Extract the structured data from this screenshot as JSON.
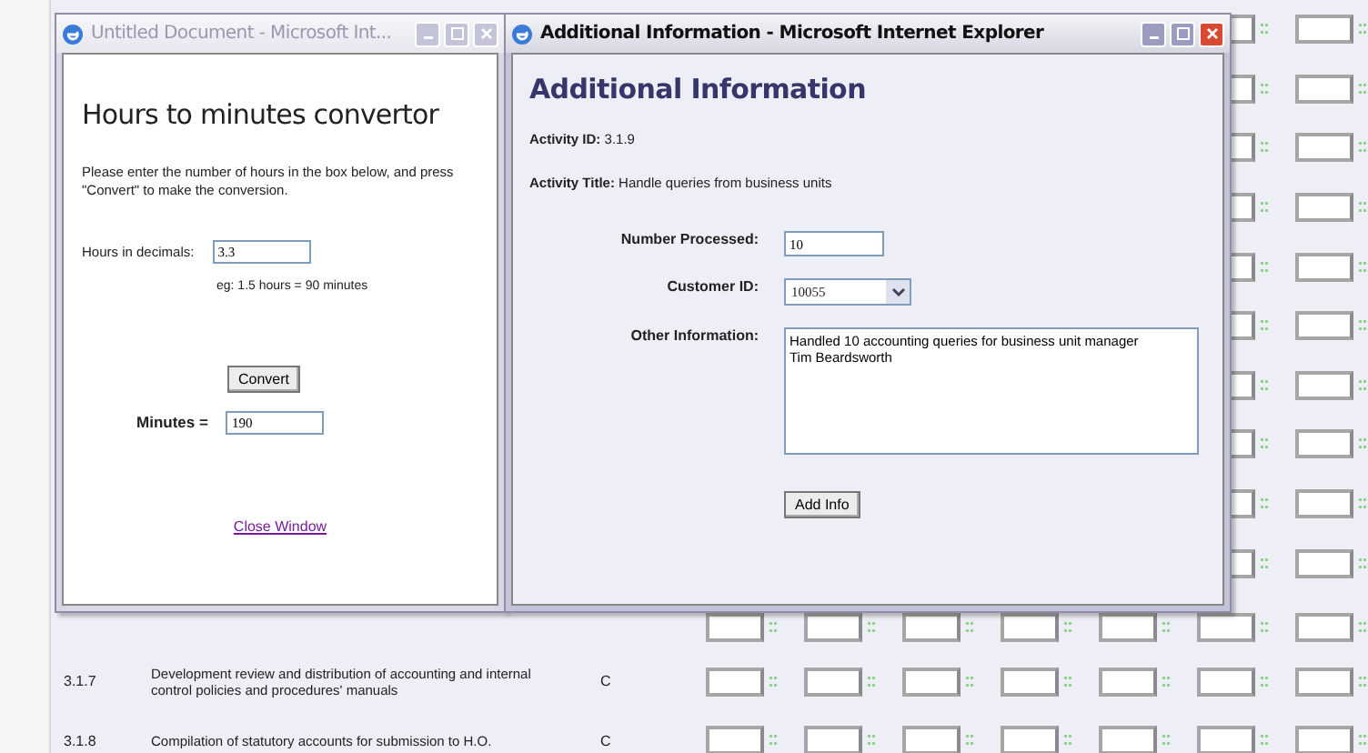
{
  "background_page": {
    "rows": [
      {
        "kind": "covered"
      },
      {
        "kind": "covered"
      },
      {
        "kind": "covered"
      },
      {
        "kind": "covered"
      },
      {
        "kind": "covered"
      },
      {
        "kind": "covered"
      },
      {
        "kind": "covered"
      },
      {
        "kind": "covered"
      },
      {
        "kind": "covered"
      },
      {
        "kind": "covered"
      },
      {
        "kind": "partly_covered"
      },
      {
        "kind": "full",
        "code": "3.1.7",
        "description": "Development review and distribution of accounting and internal control policies and procedures' manuals",
        "rating": "C"
      },
      {
        "kind": "full",
        "code": "3.1.8",
        "description": "Compilation of statutory accounts for submission to H.O.",
        "rating": "C"
      }
    ]
  },
  "converter_window": {
    "title": "Untitled Document - Microsoft Int...",
    "active": false,
    "heading": "Hours to minutes convertor",
    "instructions": "Please enter the number of hours in the box below, and press \"Convert\" to make the conversion.",
    "hours_label": "Hours in decimals:",
    "hours_value": "3.3",
    "example": "eg: 1.5 hours = 90 minutes",
    "convert_button": "Convert",
    "minutes_label": "Minutes =",
    "minutes_value": "190",
    "close_link": "Close Window"
  },
  "info_window": {
    "title": "Additional Information - Microsoft Internet Explorer",
    "active": true,
    "heading": "Additional Information",
    "activity_id": "**Activity ID:** 3.1.9",
    "activity_title": "**Activity Title:** Handle queries from business units",
    "number_processed_label": "Number Processed:",
    "number_processed": "10",
    "customer_id_label": "Customer ID:",
    "customer_id": "10055",
    "other_info_label": "Other Information:",
    "other_info": "Handled 10 accounting queries for business unit manager Tim Beardsworth",
    "add_button": "Add Info"
  }
}
